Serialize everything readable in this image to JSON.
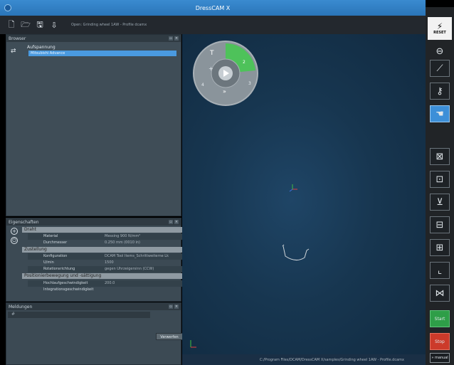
{
  "app": {
    "title": "DressCAM X"
  },
  "toolbar": {
    "icons": [
      "new-file-icon",
      "open-folder-icon",
      "save-icon",
      "export-icon"
    ],
    "file_path": "Open: Grinding wheel 1AW - Profile dcamx"
  },
  "browser": {
    "title": "Browser",
    "root_label": "Aufspannung",
    "selected_item": "Mitsubishi Advance"
  },
  "properties": {
    "title": "Eigenschaften",
    "groups": [
      {
        "label": "Draht",
        "rows": [
          {
            "key": "Material",
            "value": "Messing 900 N/mm²"
          },
          {
            "key": "Durchmesser",
            "value": "0.250 mm (0010 in)"
          }
        ]
      },
      {
        "label": "Zustellung",
        "rows": [
          {
            "key": "Konfiguration",
            "value": "DCAM Tool Items_Schrittweiterne Lk"
          },
          {
            "key": "U/min",
            "value": "1500"
          },
          {
            "key": "Rotationsrichtung",
            "value": "gegen Uhrzeigersinn (CCW)"
          }
        ]
      },
      {
        "label": "Positionierbewegung und -sättigung",
        "rows": [
          {
            "key": "Hochlaufgeschwindigkeit",
            "value": "200.0"
          },
          {
            "key": "Integrationsgeschwindigkeit",
            "value": ""
          }
        ]
      }
    ]
  },
  "messages": {
    "title": "Meldungen",
    "col_header": "#",
    "discard_label": "Verwerfen"
  },
  "status": {
    "path": "C:/Program Files/DCAM/DressCAM X/samples/Grinding wheel 1AW - Profile.dcamx"
  },
  "rightbar": {
    "reset_label": "RESET",
    "start_label": "Start",
    "stop_label": "Stop",
    "manual_label": "» manual"
  },
  "wheel": {
    "labels": [
      "T",
      "+",
      "2",
      "3",
      "4"
    ]
  },
  "colors": {
    "accent": "#3d8fd8",
    "start": "#2e9e48",
    "stop": "#cc3a2a",
    "wheel_active": "#4ec25a"
  }
}
